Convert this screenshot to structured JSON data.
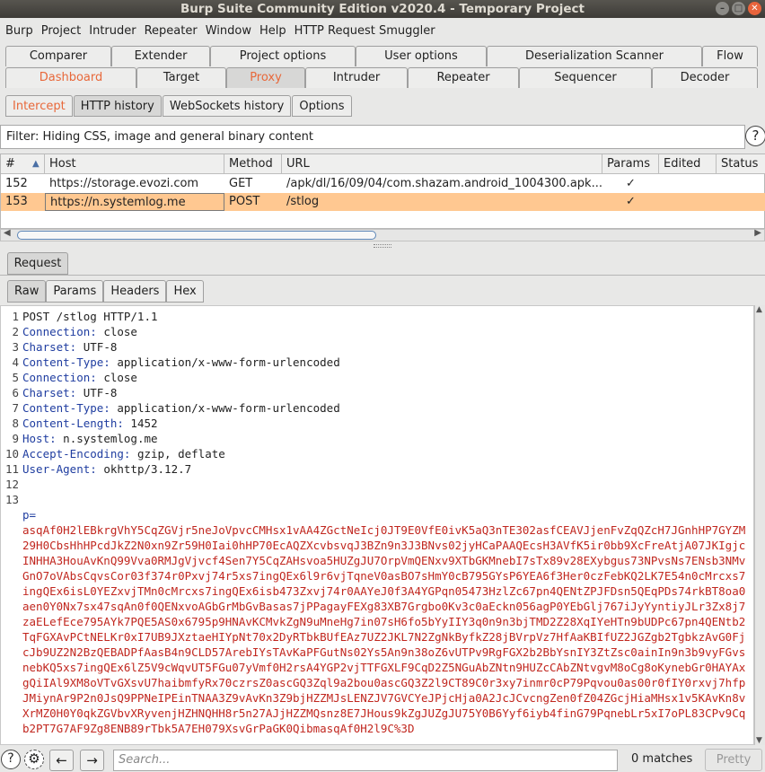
{
  "window": {
    "title": "Burp Suite Community Edition v2020.4 - Temporary Project"
  },
  "menu": [
    "Burp",
    "Project",
    "Intruder",
    "Repeater",
    "Window",
    "Help",
    "HTTP Request Smuggler"
  ],
  "main_tabs_row1": [
    "Comparer",
    "Extender",
    "Project options",
    "User options",
    "Deserialization Scanner",
    "Flow"
  ],
  "main_tabs_row2": [
    "Dashboard",
    "Target",
    "Proxy",
    "Intruder",
    "Repeater",
    "Sequencer",
    "Decoder"
  ],
  "proxy_tabs": [
    "Intercept",
    "HTTP history",
    "WebSockets history",
    "Options"
  ],
  "filter": {
    "text": "Filter: Hiding CSS, image and general binary content"
  },
  "history": {
    "columns": [
      "#",
      "Host",
      "Method",
      "URL",
      "Params",
      "Edited",
      "Status"
    ],
    "rows": [
      {
        "num": "152",
        "host": "https://storage.evozi.com",
        "method": "GET",
        "url": "/apk/dl/16/09/04/com.shazam.android_1004300.apk...",
        "params": "✓",
        "edited": "",
        "status": ""
      },
      {
        "num": "153",
        "host": "https://n.systemlog.me",
        "method": "POST",
        "url": "/stlog",
        "params": "✓",
        "edited": "",
        "status": ""
      }
    ]
  },
  "request_tab": "Request",
  "message_tabs": [
    "Raw",
    "Params",
    "Headers",
    "Hex"
  ],
  "request_lines": [
    {
      "n": "1",
      "key": "",
      "val": "POST /stlog HTTP/1.1"
    },
    {
      "n": "2",
      "key": "Connection:",
      "val": " close"
    },
    {
      "n": "3",
      "key": "Charset:",
      "val": " UTF-8"
    },
    {
      "n": "4",
      "key": "Content-Type:",
      "val": " application/x-www-form-urlencoded"
    },
    {
      "n": "5",
      "key": "Connection:",
      "val": " close"
    },
    {
      "n": "6",
      "key": "Charset:",
      "val": " UTF-8"
    },
    {
      "n": "7",
      "key": "Content-Type:",
      "val": " application/x-www-form-urlencoded"
    },
    {
      "n": "8",
      "key": "Content-Length:",
      "val": " 1452"
    },
    {
      "n": "9",
      "key": "Host:",
      "val": " n.systemlog.me"
    },
    {
      "n": "10",
      "key": "Accept-Encoding:",
      "val": " gzip, deflate"
    },
    {
      "n": "11",
      "key": "User-Agent:",
      "val": " okhttp/3.12.7"
    },
    {
      "n": "12",
      "key": "",
      "val": ""
    },
    {
      "n": "13",
      "key": "",
      "val": ""
    }
  ],
  "body_param": "p=",
  "body_value": "asqAf0H2lEBkrgVhY5CqZGVjr5neJoVpvcCMHsx1vAA4ZGctNeIcj0JT9E0VfE0ivK5aQ3nTE302asfCEAVJjenFvZqQZcH7JGnhHP7GYZM29H0CbsHhHPcdJkZ2N0xn9Zr59H0Iai0hHP70EcAQZXcvbsvqJ3BZn9n3J3BNvs02jyHCaPAAQEcsH3AVfK5ir0bb9XcFreAtjA07JKIgjcINHHA3HouAvKnQ99Vva0RMJgVjvcf4Sen7Y5CqZAHsvoa5HUZgJU7OrpVmQENxv9XTbGKMnebI7sTx89v28EXybgus73NPvsNs7ENsb3NMvGnO7oVAbsCqvsCor03f374r0Pxvj74r5xs7ingQEx6l9r6vjTqneV0asBO7sHmY0cB795GYsP6YEA6f3Her0czFebKQ2LK7E54n0cMrcxs7ingQEx6isL0YEZxvjTMn0cMrcxs7ingQEx6isb473Zxvj74r0AAYeJ0f3A4YGPqn05473HzlZc67pn4QENtZPJFDsn5QEqPDs74rkBT8oa0aen0Y0Nx7sx47sqAn0f0QENxvoAGbGrMbGvBasas7jPPagayFEXg83XB7Grgbo0Kv3c0aEckn056agP0YEbGlj767iJyYyntiyJLr3Zx8j7zaELefEce795AYk7PQE5AS0x6795p9HNAvKCMvkZgN9uMneHg7in07sH6fo5bYyIIY3q0n9n3bjTMD2Z28XqIYeHTn9bUDPc67pn4QENtb2TqFGXAvPCtNELKr0xI7UB9JXztaeHIYpNt70x2DyRTbkBUfEAz7UZ2JKL7N2ZgNkByfkZ28jBVrpVz7HfAaKBIfUZ2JGZgb2TgbkzAvG0FjcJb9UZ2N2BzQEBADPfAasB4n9CLD57ArebIYsTAvKaPFGutNs02Ys5An9n38oZ6vUTPv9RgFGX2b2BbYsnIY3ZtZsc0ainIn9n3b9vyFGvsnebKQ5xs7ingQEx6lZ5V9cWqvUT5FGu07yVmf0H2rsA4YGP2vjTTFGXLF9CqD2Z5NGuAbZNtn9HUZcCAbZNtvgvM8oCg8oKynebGr0HAYAxgQiIAl9XM8oVTvGXsvU7haibmfyRx70czrsZ0ascGQ3Zql9a2bou0ascGQ3Z2l9CT89C0r3xy7inmr0cP79Pqvou0as00r0fIY0rxvj7hfpJMiynAr9P2n0JsQ9PPNeIPEinTNAA3Z9vAvKn3Z9bjHZZMJsLENZJV7GVCYeJPjcHja0A2JcJCvcngZen0fZ04ZGcjHiaMHsx1v5KAvKn8vXrMZ0H0Y0qkZGVbvXRyvenjHZHNQHH8r5n27AJjHZZMQsnz8E7JHous9kZgJUZgJU75Y0B6Yyf6iyb4finG79PqnebLr5xI7oPL83CPv9Cqb2PT7G7AF9Zg8ENB89rTbk5A7EH079XsvGrPaGK0QibmasqAf0H2l9C%3D",
  "bottom": {
    "search_placeholder": "Search...",
    "matches": "0 matches",
    "pretty": "Pretty"
  }
}
